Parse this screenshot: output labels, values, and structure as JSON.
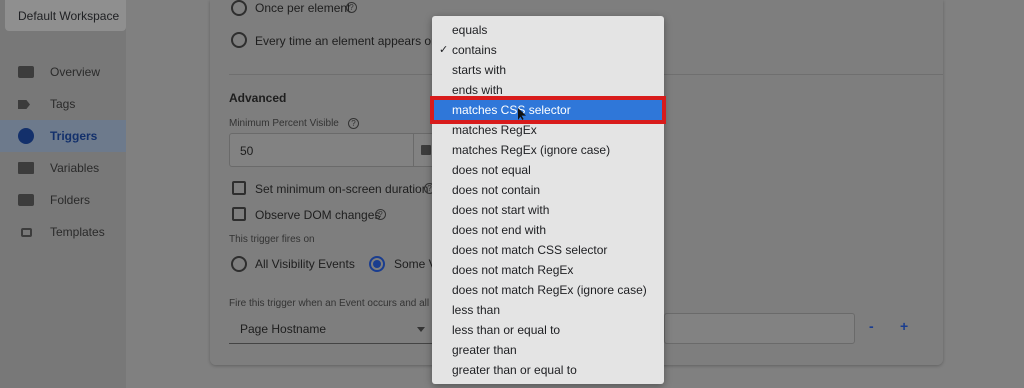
{
  "workspace": {
    "label": "Default Workspace"
  },
  "sidebar": {
    "items": [
      {
        "label": "Overview",
        "icon": "briefcase-icon"
      },
      {
        "label": "Tags",
        "icon": "tag-icon"
      },
      {
        "label": "Triggers",
        "icon": "trigger-icon",
        "active": true
      },
      {
        "label": "Variables",
        "icon": "variables-icon"
      },
      {
        "label": "Folders",
        "icon": "folder-icon"
      },
      {
        "label": "Templates",
        "icon": "template-icon"
      }
    ]
  },
  "fire_options": {
    "once_per_element": "Once per element",
    "every_time": "Every time an element appears on s"
  },
  "advanced": {
    "heading": "Advanced",
    "min_percent_label": "Minimum Percent Visible",
    "min_percent_value": "50",
    "min_duration_label": "Set minimum on-screen duration",
    "observe_dom_label": "Observe DOM changes"
  },
  "trigger_fires_on": {
    "label": "This trigger fires on",
    "all_events": "All Visibility Events",
    "some_events": "Some V",
    "selected": "some"
  },
  "condition": {
    "label": "Fire this trigger when an Event occurs and all",
    "variable": "Page Hostname",
    "minus": "-",
    "plus": "+"
  },
  "operator_dropdown": {
    "options": [
      "equals",
      "contains",
      "starts with",
      "ends with",
      "matches CSS selector",
      "matches RegEx",
      "matches RegEx (ignore case)",
      "does not equal",
      "does not contain",
      "does not start with",
      "does not end with",
      "does not match CSS selector",
      "does not match RegEx",
      "does not match RegEx (ignore case)",
      "less than",
      "less than or equal to",
      "greater than",
      "greater than or equal to"
    ],
    "checked": "contains",
    "highlighted": "matches CSS selector"
  },
  "colors": {
    "accent": "#1a3d8f",
    "highlight": "#2f77d9",
    "annotation_box": "#d81b1b"
  }
}
